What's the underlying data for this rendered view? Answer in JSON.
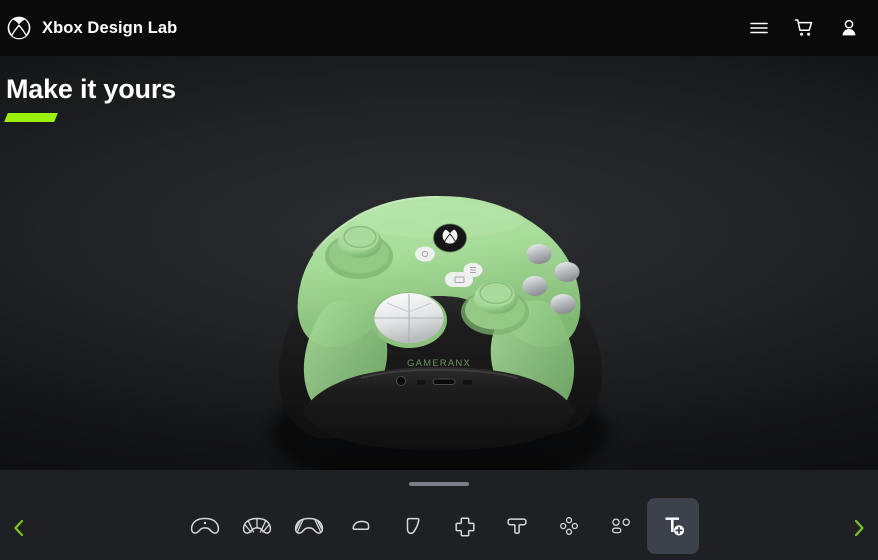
{
  "header": {
    "logo_icon": "xbox-logo-icon",
    "title": "Xbox Design Lab",
    "actions": [
      {
        "icon": "hamburger-menu-icon",
        "label": "Menu"
      },
      {
        "icon": "shopping-cart-icon",
        "label": "Cart"
      },
      {
        "icon": "account-person-icon",
        "label": "Account"
      }
    ]
  },
  "hero": {
    "title": "Make it yours",
    "accent_color": "#9bf00b",
    "background_color": "#222427"
  },
  "product": {
    "name": "Xbox Wireless Controller",
    "engraving_text": "GAMERANX",
    "body_color": "#a8dd9b",
    "back_case_color": "#1b1b1b",
    "dpad_color": "#f2f3f3",
    "abxy_color": "#c9cbcd",
    "thumbstick_color": "#a5d898",
    "xbox_button_color": "#141414",
    "menu_buttons_color": "#f0f1f1"
  },
  "bottom_bar": {
    "background_color": "#1e2024",
    "drag_handle": "drag-handle",
    "prev_arrow": {
      "icon": "chevron-left-icon",
      "color": "#7dc521"
    },
    "next_arrow": {
      "icon": "chevron-right-icon",
      "color": "#7dc521"
    },
    "selected_index": 8,
    "selected_background": "#3d414c",
    "tools": [
      {
        "icon": "controller-body-icon",
        "label": "Body"
      },
      {
        "icon": "controller-back-icon",
        "label": "Back"
      },
      {
        "icon": "controller-grips-icon",
        "label": "Grips"
      },
      {
        "icon": "bumper-icon",
        "label": "Bumpers"
      },
      {
        "icon": "trigger-icon",
        "label": "Triggers"
      },
      {
        "icon": "dpad-icon",
        "label": "D-pad"
      },
      {
        "icon": "thumbstick-icon",
        "label": "Thumbsticks"
      },
      {
        "icon": "abxy-buttons-icon",
        "label": "ABXY"
      },
      {
        "icon": "view-menu-buttons-icon",
        "label": "View & Menu buttons"
      },
      {
        "icon": "add-engraving-icon",
        "label": "Add engraving"
      }
    ]
  }
}
